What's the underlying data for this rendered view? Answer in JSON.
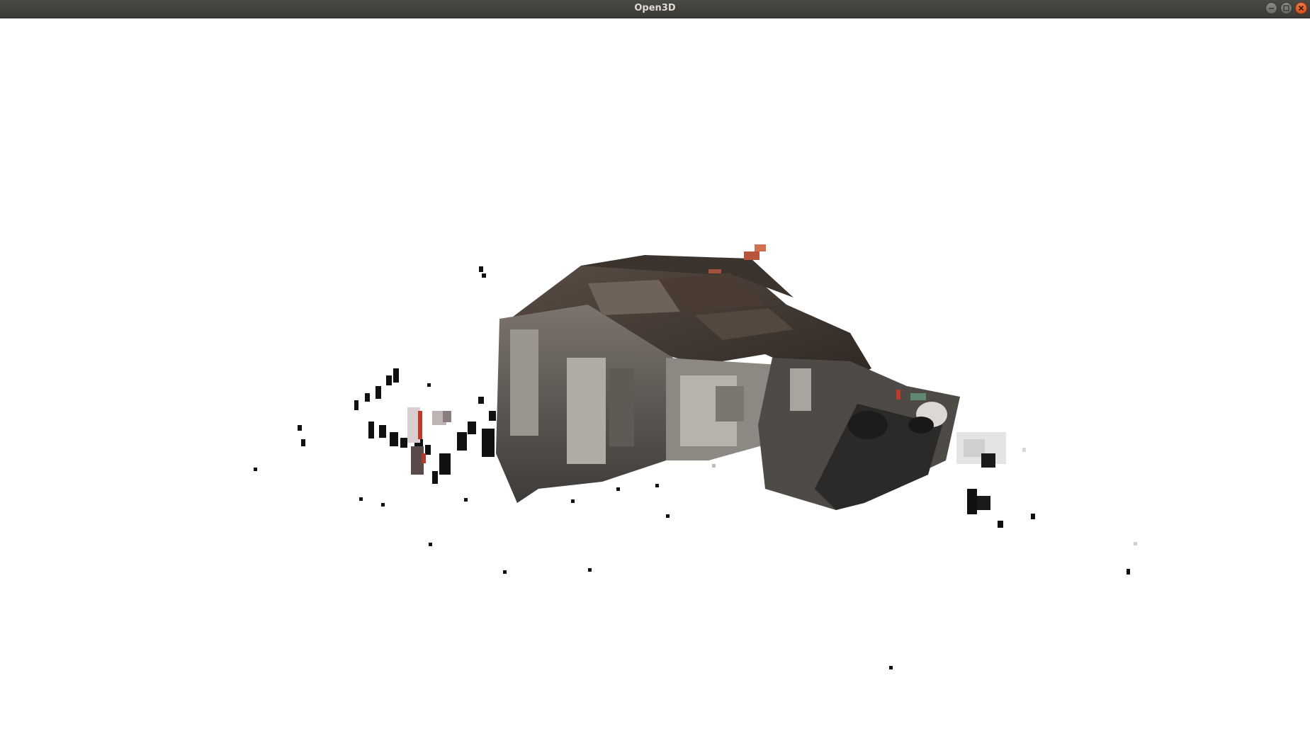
{
  "window": {
    "title": "Open3D",
    "controls": {
      "minimize_icon": "minimize-icon",
      "maximize_icon": "maximize-icon",
      "close_icon": "close-icon"
    }
  },
  "viewport": {
    "background": "#ffffff",
    "content": "point-cloud"
  }
}
